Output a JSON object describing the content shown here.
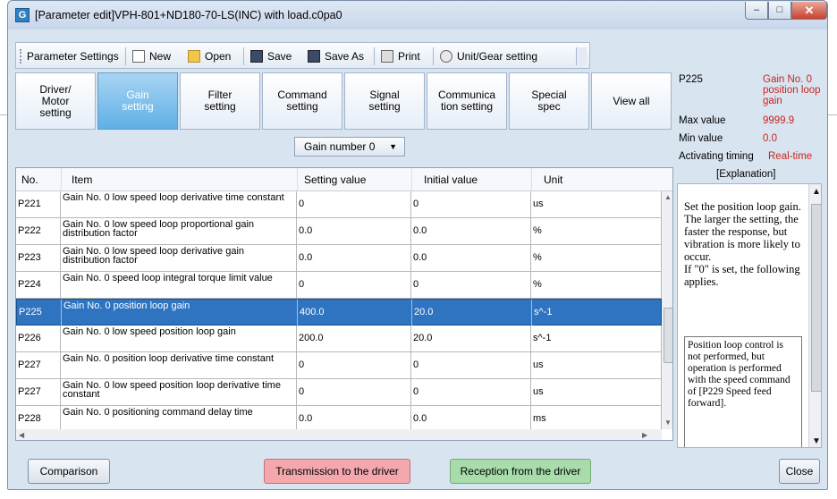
{
  "window": {
    "title": "[Parameter edit]VPH-801+ND180-70-LS(INC) with load.c0pa0",
    "app_icon_glyph": "G",
    "controls": {
      "minimize": "–",
      "maximize": "□",
      "close": "✕"
    }
  },
  "toolbar": {
    "items": [
      {
        "label": "Parameter Settings",
        "icon": ""
      },
      {
        "label": "New",
        "icon": "new-file-icon"
      },
      {
        "label": "Open",
        "icon": "open-folder-icon"
      },
      {
        "label": "Save",
        "icon": "save-icon"
      },
      {
        "label": "Save As",
        "icon": "save-as-icon"
      },
      {
        "label": "Print",
        "icon": "print-icon"
      },
      {
        "label": "Unit/Gear setting",
        "icon": "gear-icon"
      }
    ]
  },
  "tabs": [
    {
      "label": "Driver/\nMotor\nsetting"
    },
    {
      "label": "Gain\nsetting",
      "active": true
    },
    {
      "label": "Filter\nsetting"
    },
    {
      "label": "Command\nsetting"
    },
    {
      "label": "Signal\nsetting"
    },
    {
      "label": "Communica\ntion setting"
    },
    {
      "label": "Special\nspec"
    },
    {
      "label": "View all"
    }
  ],
  "gain_select": {
    "value": "Gain number 0"
  },
  "param_info": {
    "id": "P225",
    "name": "Gain No. 0 position loop gain",
    "max_label": "Max value",
    "max_value": "9999.9",
    "min_label": "Min value",
    "min_value": "0.0",
    "timing_label": "Activating timing",
    "timing_value": "Real-time",
    "explanation_header": "[Explanation]"
  },
  "grid": {
    "columns": [
      "No.",
      "Item",
      "Setting value",
      "Initial value",
      "Unit"
    ],
    "rows": [
      {
        "no": "P221",
        "item": "Gain No. 0 low speed loop derivative time constant",
        "setting": "0",
        "initial": "0",
        "unit": "us"
      },
      {
        "no": "P222",
        "item": "Gain No. 0 low speed loop proportional gain distribution factor",
        "setting": "0.0",
        "initial": "0.0",
        "unit": "%"
      },
      {
        "no": "P223",
        "item": "Gain No. 0 low speed loop derivative gain distribution factor",
        "setting": "0.0",
        "initial": "0.0",
        "unit": "%"
      },
      {
        "no": "P224",
        "item": "Gain No. 0 speed loop integral torque limit value",
        "setting": "0",
        "initial": "0",
        "unit": "%"
      },
      {
        "no": "P225",
        "item": "Gain No. 0 position loop gain",
        "setting": "400.0",
        "initial": "20.0",
        "unit": "s^-1",
        "selected": true
      },
      {
        "no": "P226",
        "item": "Gain No. 0 low speed position loop gain",
        "setting": "200.0",
        "initial": "20.0",
        "unit": "s^-1"
      },
      {
        "no": "P227",
        "item": "Gain No. 0 position loop derivative time constant",
        "setting": "0",
        "initial": "0",
        "unit": "us"
      },
      {
        "no": "P227",
        "item": "Gain No. 0 low speed position loop derivative time constant",
        "setting": "0",
        "initial": "0",
        "unit": "us"
      },
      {
        "no": "P228",
        "item": "Gain No. 0 positioning command delay time",
        "setting": "0.0",
        "initial": "0.0",
        "unit": "ms"
      }
    ]
  },
  "explanation": {
    "text": "Set the position loop gain.\nThe larger the setting, the faster the response, but vibration is more likely to occur.\nIf \"0\" is set, the following applies.",
    "box_text": "Position loop control is not performed, but operation is performed with the speed command of [P229 Speed feed forward]."
  },
  "buttons": {
    "comparison": "Comparison",
    "transmission": "Transmission to the driver",
    "reception": "Reception from the driver",
    "close": "Close"
  }
}
